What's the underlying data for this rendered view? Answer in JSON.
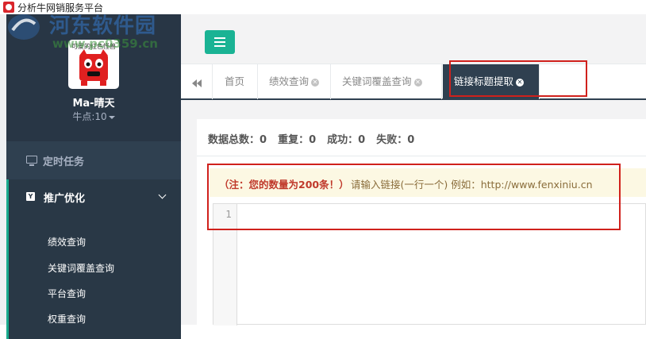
{
  "window": {
    "title": "分析牛网销服务平台"
  },
  "watermark": {
    "name": "河东软件园",
    "url": "www.pc0359.cn"
  },
  "sidebar": {
    "avatar_caption": "可爱的红色怪兽",
    "user_name": "Ma-晴天",
    "points_label": "牛点:",
    "points_value": "10",
    "timed_task_label": "定时任务",
    "promo_label": "推广优化",
    "promo_badge": "Y",
    "sub_items": [
      "绩效查询",
      "关键词覆盖查询",
      "平台查询",
      "权重查询"
    ]
  },
  "tabs": [
    {
      "label": "首页",
      "closable": false,
      "active": false
    },
    {
      "label": "绩效查询",
      "closable": true,
      "active": false
    },
    {
      "label": "关键词覆盖查询",
      "closable": true,
      "active": false
    },
    {
      "label": "链接标题提取",
      "closable": true,
      "active": true
    }
  ],
  "stats": [
    {
      "label": "数据总数：",
      "value": "0"
    },
    {
      "label": "重复：",
      "value": "0"
    },
    {
      "label": "成功：",
      "value": "0"
    },
    {
      "label": "失败：",
      "value": "0"
    }
  ],
  "notice": {
    "warning": "（注：您的数量为200条！）",
    "help": "请输入链接(一行一个)   例如：http://www.fenxiniu.cn"
  },
  "editor": {
    "line_number": "1",
    "content": ""
  },
  "colors": {
    "accent": "#1ab394",
    "sidebar": "#2f4050",
    "annotation": "#d0211c"
  }
}
